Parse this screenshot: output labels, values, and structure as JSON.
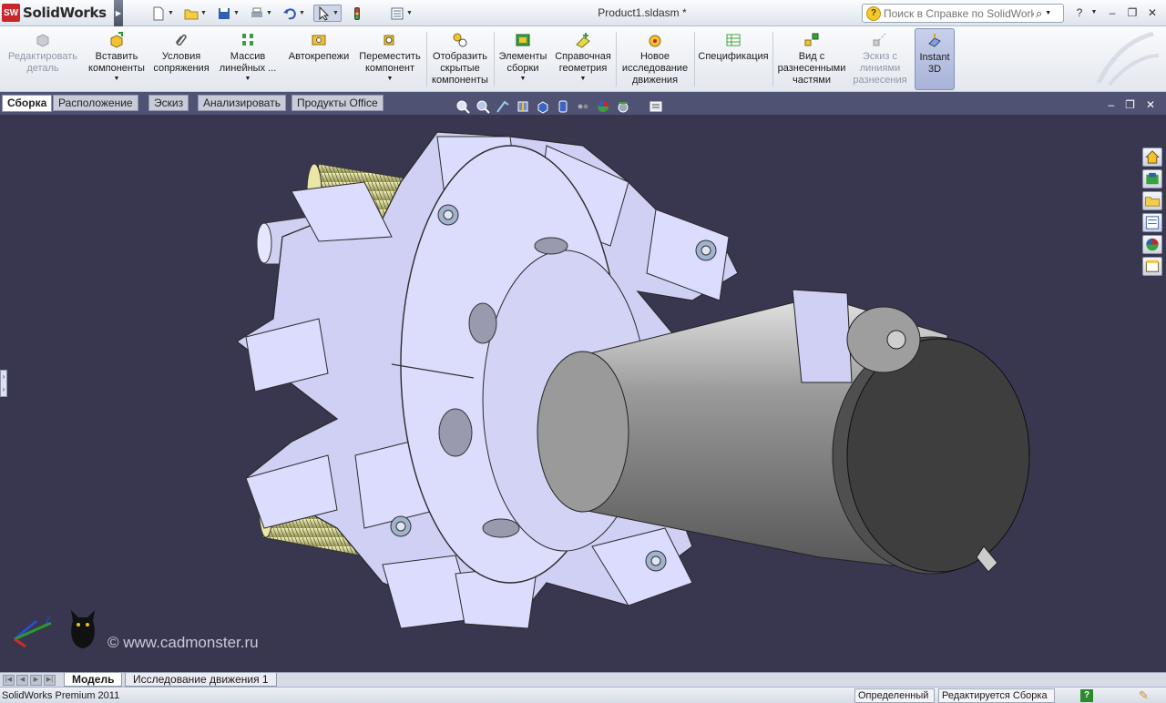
{
  "app": {
    "name": "SolidWorks",
    "logo_badge": "SW",
    "document_title": "Product1.sldasm *"
  },
  "help_search": {
    "placeholder": "Поиск в Справке по SolidWorks"
  },
  "ribbon": {
    "buttons": [
      {
        "id": "edit-part",
        "label1": "Редактировать",
        "label2": "деталь",
        "enabled": false
      },
      {
        "id": "insert-components",
        "label1": "Вставить",
        "label2": "компоненты",
        "dropdown": true
      },
      {
        "id": "mate",
        "label1": "Условия",
        "label2": "сопряжения"
      },
      {
        "id": "linear-pattern",
        "label1": "Массив",
        "label2": "линейных ...",
        "dropdown": true
      },
      {
        "id": "smart-fasteners",
        "label1": "Автокрепежи"
      },
      {
        "id": "move-component",
        "label1": "Переместить",
        "label2": "компонент",
        "dropdown": true
      },
      {
        "id": "show-hidden",
        "label1": "Отобразить",
        "label2": "скрытые",
        "label3": "компоненты"
      },
      {
        "id": "assembly-features",
        "label1": "Элементы",
        "label2": "сборки",
        "dropdown": true
      },
      {
        "id": "reference-geometry",
        "label1": "Справочная",
        "label2": "геометрия",
        "dropdown": true
      },
      {
        "id": "new-motion-study",
        "label1": "Новое",
        "label2": "исследование",
        "label3": "движения"
      },
      {
        "id": "bom",
        "label1": "Спецификация"
      },
      {
        "id": "exploded-view",
        "label1": "Вид с",
        "label2": "разнесенными",
        "label3": "частями"
      },
      {
        "id": "explode-line-sketch",
        "label1": "Эскиз с",
        "label2": "линиями",
        "label3": "разнесения",
        "enabled": false
      },
      {
        "id": "instant-3d",
        "label1": "Instant",
        "label2": "3D",
        "active": true
      }
    ]
  },
  "command_tabs": [
    "Сборка",
    "Расположение",
    "Эскиз",
    "Анализировать",
    "Продукты Office"
  ],
  "active_command_tab": "Сборка",
  "bottom_tabs": [
    "Модель",
    "Исследование движения 1"
  ],
  "active_bottom_tab": "Модель",
  "status": {
    "app_version": "SolidWorks Premium 2011",
    "definition": "Определенный",
    "editing": "Редактируется Сборка",
    "help_icon": "?"
  },
  "watermark": "© www.cadmonster.ru",
  "colors": {
    "background": "#38374f",
    "ribbon_bg": "#e8ebf1",
    "accent": "#c8262b",
    "tabs_bg": "#4f5272"
  }
}
